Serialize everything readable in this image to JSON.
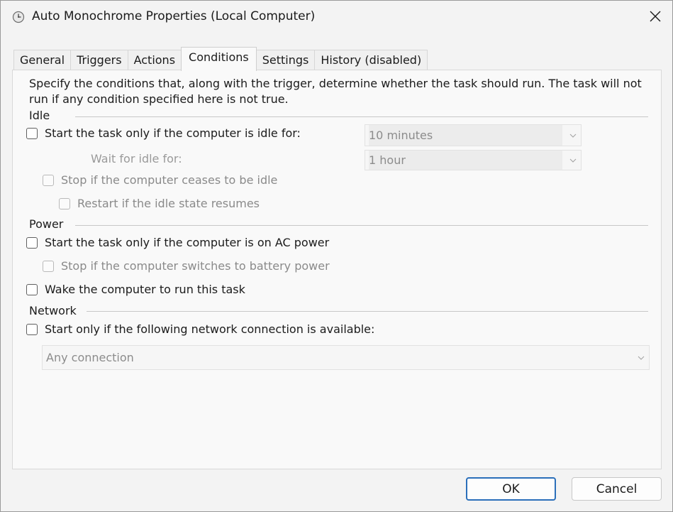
{
  "window": {
    "title": "Auto Monochrome Properties (Local Computer)"
  },
  "tabs": [
    {
      "label": "General"
    },
    {
      "label": "Triggers"
    },
    {
      "label": "Actions"
    },
    {
      "label": "Conditions"
    },
    {
      "label": "Settings"
    },
    {
      "label": "History (disabled)"
    }
  ],
  "active_tab": "Conditions",
  "conditions": {
    "description": "Specify the conditions that, along with the trigger, determine whether the task should run.  The task will not run  if any condition specified here is not true.",
    "idle": {
      "group_label": "Idle",
      "start_if_idle_label": "Start the task only if the computer is idle for:",
      "start_if_idle_checked": false,
      "idle_duration_value": "10 minutes",
      "wait_for_idle_label": "Wait for idle for:",
      "wait_for_idle_value": "1 hour",
      "stop_if_ceases_label": "Stop if the computer ceases to be idle",
      "stop_if_ceases_checked": false,
      "restart_if_resumes_label": "Restart if the idle state resumes",
      "restart_if_resumes_checked": false
    },
    "power": {
      "group_label": "Power",
      "ac_power_label": "Start the task only if the computer is on AC power",
      "ac_power_checked": false,
      "stop_battery_label": "Stop if the computer switches to battery power",
      "stop_battery_checked": false,
      "wake_label": "Wake the computer to run this task",
      "wake_checked": false
    },
    "network": {
      "group_label": "Network",
      "network_label": "Start only if the following network connection is available:",
      "network_checked": false,
      "connection_value": "Any connection"
    }
  },
  "buttons": {
    "ok": "OK",
    "cancel": "Cancel"
  },
  "colors": {
    "accent_border": "#2b6fba",
    "panel_bg": "#f9f9f9",
    "window_bg": "#f3f3f3"
  }
}
